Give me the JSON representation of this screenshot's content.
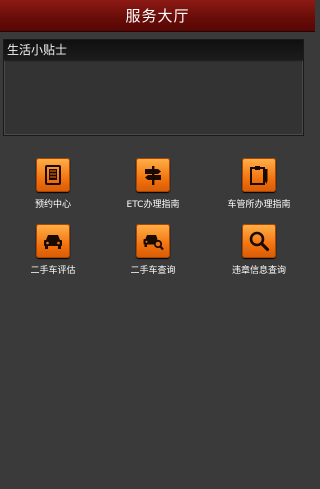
{
  "header": {
    "title": "服务大厅"
  },
  "tips": {
    "title": "生活小贴士"
  },
  "services": [
    {
      "label": "预约中心",
      "icon": "document-icon"
    },
    {
      "label": "ETC办理指南",
      "icon": "signpost-icon"
    },
    {
      "label": "车管所办理指南",
      "icon": "clipboard-icon"
    },
    {
      "label": "二手车评估",
      "icon": "car-icon"
    },
    {
      "label": "二手车查询",
      "icon": "car-search-icon"
    },
    {
      "label": "违章信息查询",
      "icon": "magnifier-icon"
    }
  ],
  "colors": {
    "titlebar": "#6a0d09",
    "icon_orange": "#f27410",
    "background": "#3a3a3a"
  }
}
